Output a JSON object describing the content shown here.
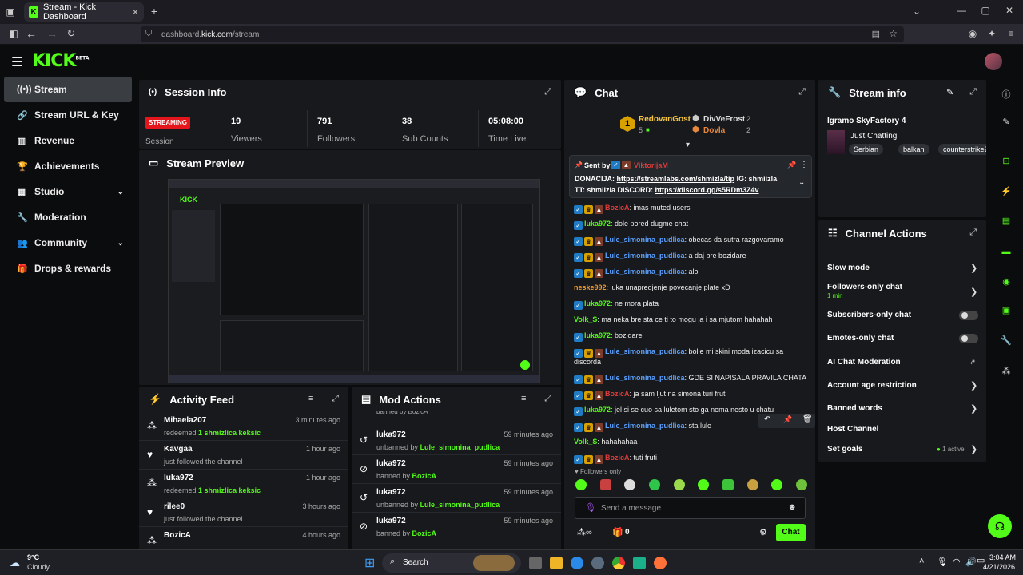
{
  "browser": {
    "tab_title": "Stream - Kick Dashboard",
    "url_prefix": "dashboard.",
    "url_domain": "kick.com",
    "url_path": "/stream"
  },
  "brand": {
    "logo": "KICK",
    "logo_sup": "BETA",
    "accent": "#53fc18"
  },
  "sidebar": {
    "items": [
      {
        "label": "Stream",
        "icon": "radio-icon"
      },
      {
        "label": "Stream URL & Key",
        "icon": "link-icon"
      },
      {
        "label": "Revenue",
        "icon": "chart-icon"
      },
      {
        "label": "Achievements",
        "icon": "trophy-icon"
      },
      {
        "label": "Studio",
        "icon": "studio-icon"
      },
      {
        "label": "Moderation",
        "icon": "wrench-icon"
      },
      {
        "label": "Community",
        "icon": "people-icon"
      },
      {
        "label": "Drops & rewards",
        "icon": "gift-icon"
      }
    ]
  },
  "session": {
    "title": "Session Info",
    "status": "STREAMING",
    "status_label": "Session",
    "viewers": "19",
    "viewers_label": "Viewers",
    "followers": "791",
    "followers_label": "Followers",
    "subs": "38",
    "subs_label": "Sub Counts",
    "time": "05:08:00",
    "time_label": "Time Live"
  },
  "preview": {
    "title": "Stream Preview"
  },
  "activity": {
    "title": "Activity Feed",
    "rows": [
      {
        "name": "Mihaela207",
        "pre": "redeemed ",
        "reward": "1 shmizlica keksic",
        "time": "3 minutes ago",
        "icon": "coins-icon"
      },
      {
        "name": "Kavgaa",
        "pre": "just followed the channel",
        "reward": "",
        "time": "1 hour ago",
        "icon": "heart-icon"
      },
      {
        "name": "luka972",
        "pre": "redeemed ",
        "reward": "1 shmizlica keksic",
        "time": "1 hour ago",
        "icon": "coins-icon"
      },
      {
        "name": "rilee0",
        "pre": "just followed the channel",
        "reward": "",
        "time": "3 hours ago",
        "icon": "heart-icon"
      },
      {
        "name": "BozicA",
        "pre": "",
        "reward": "",
        "time": "4 hours ago",
        "icon": "coins-icon"
      }
    ]
  },
  "mod": {
    "title": "Mod Actions",
    "top_cut": "banned by BozicA",
    "rows": [
      {
        "name": "luka972",
        "pre": "unbanned by ",
        "by": "Lule_simonina_pudlica",
        "time": "59 minutes ago",
        "icon": "undo-icon"
      },
      {
        "name": "luka972",
        "pre": "banned by ",
        "by": "BozicA",
        "time": "59 minutes ago",
        "icon": "ban-icon"
      },
      {
        "name": "luka972",
        "pre": "unbanned by ",
        "by": "Lule_simonina_pudlica",
        "time": "59 minutes ago",
        "icon": "undo-icon"
      },
      {
        "name": "luka972",
        "pre": "banned by ",
        "by": "BozicA",
        "time": "59 minutes ago",
        "icon": "ban-icon"
      }
    ]
  },
  "chat": {
    "title": "Chat",
    "leader1": {
      "name": "RedovanGost",
      "count": "5"
    },
    "leader2": {
      "name": "DivVeFrost",
      "count": "2"
    },
    "leader3": {
      "name": "Dovla",
      "count": "2"
    },
    "pinned": {
      "sent_by": "Sent by",
      "author": "ViktorijaM",
      "l1a": "DONACIJA: ",
      "l1link": "https://streamlabs.com/shmizla/tip",
      "l1b": " IG: shmiizla",
      "l2a": "TT: shmiizla  DISCORD: ",
      "l2link": "https://discord.gg/s5RDm3Z4v"
    },
    "messages": [
      {
        "badges": "v,c,s",
        "name": "BozicA",
        "color": "#e03a3a",
        "text": ": imas muted users"
      },
      {
        "badges": "v",
        "name": "luka972",
        "color": "#53fc18",
        "text": ": dole pored dugme chat"
      },
      {
        "badges": "v,c,s",
        "name": "Lule_simonina_pudlica",
        "color": "#5aa0ff",
        "text": ": obecas da sutra razgovaramo"
      },
      {
        "badges": "v,c,s",
        "name": "Lule_simonina_pudlica",
        "color": "#5aa0ff",
        "text": ": a daj bre bozidare"
      },
      {
        "badges": "v,c,s",
        "name": "Lule_simonina_pudlica",
        "color": "#5aa0ff",
        "text": ": alo"
      },
      {
        "badges": "",
        "name": "neske992",
        "color": "#f2992a",
        "text": ": luka unapredjenje povecanje plate xD"
      },
      {
        "badges": "v",
        "name": "luka972",
        "color": "#53fc18",
        "text": ": ne mora plata"
      },
      {
        "badges": "",
        "name": "Volk_S",
        "color": "#53fc18",
        "text": ": ma neka bre sta ce ti to mogu ja i sa mjutom hahahah"
      },
      {
        "badges": "v",
        "name": "luka972",
        "color": "#53fc18",
        "text": ": bozidare"
      },
      {
        "badges": "v,c,s",
        "name": "Lule_simonina_pudlica",
        "color": "#5aa0ff",
        "text": ": bolje mi skini moda izacicu sa"
      },
      {
        "badges": "",
        "name": "",
        "color": "#eee",
        "text": "discorda"
      },
      {
        "badges": "v,c,s",
        "name": "Lule_simonina_pudlica",
        "color": "#5aa0ff",
        "text": ": GDE SI NAPISALA PRAVILA CHATA"
      },
      {
        "badges": "v,c,s",
        "name": "BozicA",
        "color": "#e03a3a",
        "text": ": ja sam ljut na simona turi fruti"
      },
      {
        "badges": "v",
        "name": "luka972",
        "color": "#53fc18",
        "text": ": jel si se cuo sa luletom sto ga nema nesto u chatu"
      },
      {
        "badges": "v,c,s",
        "name": "Lule_simonina_pudlica",
        "color": "#5aa0ff",
        "text": ": sta lule"
      },
      {
        "badges": "",
        "name": "Volk_S",
        "color": "#53fc18",
        "text": ": hahahahaa"
      },
      {
        "badges": "v,c,s",
        "name": "BozicA",
        "color": "#e03a3a",
        "text": ": tuti fruti"
      }
    ],
    "followers_only": "Followers only",
    "input_placeholder": "Send a message",
    "points": "0",
    "send_label": "Chat"
  },
  "stream_info": {
    "title": "Stream info",
    "stream_title": "Igramo SkyFactory 4",
    "category": "Just Chatting",
    "tags": [
      "Serbian",
      "balkan",
      "counterstrike2"
    ]
  },
  "channel_actions": {
    "title": "Channel Actions",
    "slow": "Slow mode",
    "followers_only": "Followers-only chat",
    "followers_only_sub": "1 min",
    "subs_only": "Subscribers-only chat",
    "emotes_only": "Emotes-only chat",
    "ai": "AI Chat Moderation",
    "age": "Account age restriction",
    "banned": "Banned words",
    "host": "Host Channel",
    "goals": "Set goals",
    "goals_status": "1 active"
  },
  "taskbar": {
    "temp": "9°C",
    "weather": "Cloudy",
    "search": "Search",
    "time": "3:04 AM",
    "date": "4/21/2026"
  }
}
